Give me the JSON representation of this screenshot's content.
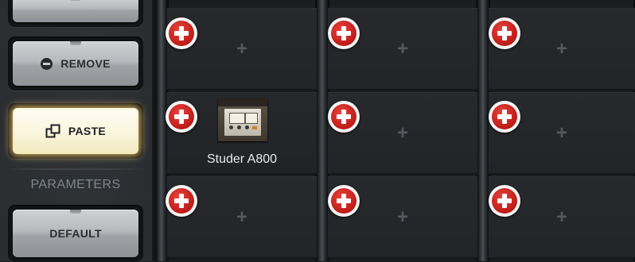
{
  "left_panel": {
    "remove_label": "REMOVE",
    "paste_label": "PASTE",
    "section_label": "PARAMETERS",
    "default_label": "DEFAULT"
  },
  "rack": {
    "slot_plus": "+",
    "loaded_plugin": {
      "name": "Studer A800"
    }
  }
}
